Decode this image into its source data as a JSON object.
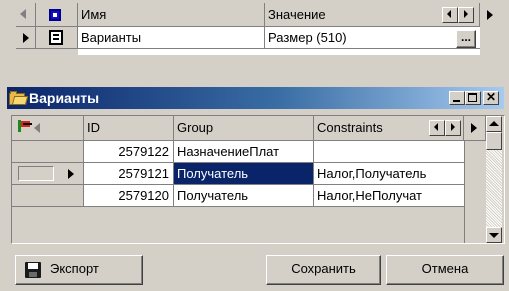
{
  "top_grid": {
    "headers": {
      "name": "Имя",
      "value": "Значение"
    },
    "row": {
      "name": "Варианты",
      "value": "Размер (510)",
      "ellipsis": "..."
    }
  },
  "dialog": {
    "title": "Варианты",
    "icon": "folder-icon",
    "controls": [
      "minimize-icon",
      "maximize-icon",
      "close-icon"
    ],
    "grid": {
      "headers": [
        "ID",
        "Group",
        "Constraints"
      ],
      "rows": [
        {
          "id": "2579122",
          "group": "НазначениеПлат",
          "constraints": ""
        },
        {
          "id": "2579121",
          "group": "Получатель",
          "constraints": "Налог,Получатель"
        },
        {
          "id": "2579120",
          "group": "Получатель",
          "constraints": "Налог,НеПолучат"
        }
      ]
    },
    "buttons": {
      "export": "Экспорт",
      "save": "Сохранить",
      "cancel": "Отмена"
    }
  },
  "colors": {
    "face": "#d4d0c8",
    "title_start": "#0a246a",
    "title_end": "#a6caf0",
    "selection": "#0a246a"
  }
}
